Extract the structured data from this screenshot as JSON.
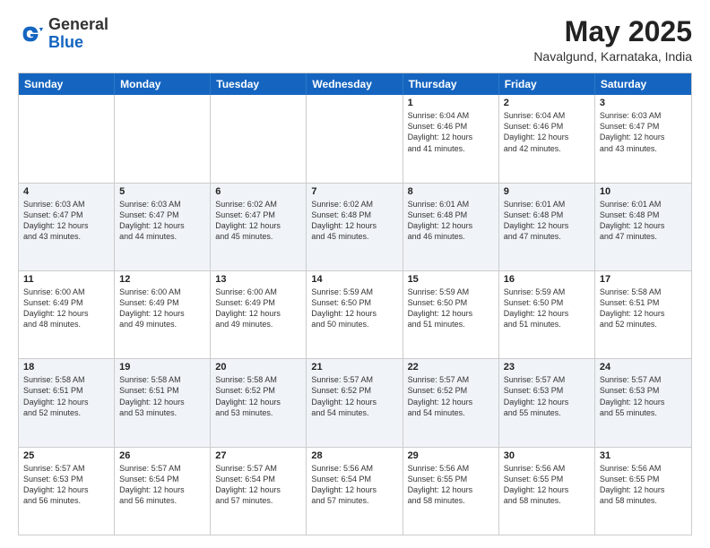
{
  "header": {
    "logo_general": "General",
    "logo_blue": "Blue",
    "month_title": "May 2025",
    "location": "Navalgund, Karnataka, India"
  },
  "weekdays": [
    "Sunday",
    "Monday",
    "Tuesday",
    "Wednesday",
    "Thursday",
    "Friday",
    "Saturday"
  ],
  "rows": [
    {
      "alt": false,
      "cells": [
        {
          "day": "",
          "info": ""
        },
        {
          "day": "",
          "info": ""
        },
        {
          "day": "",
          "info": ""
        },
        {
          "day": "",
          "info": ""
        },
        {
          "day": "1",
          "info": "Sunrise: 6:04 AM\nSunset: 6:46 PM\nDaylight: 12 hours\nand 41 minutes."
        },
        {
          "day": "2",
          "info": "Sunrise: 6:04 AM\nSunset: 6:46 PM\nDaylight: 12 hours\nand 42 minutes."
        },
        {
          "day": "3",
          "info": "Sunrise: 6:03 AM\nSunset: 6:47 PM\nDaylight: 12 hours\nand 43 minutes."
        }
      ]
    },
    {
      "alt": true,
      "cells": [
        {
          "day": "4",
          "info": "Sunrise: 6:03 AM\nSunset: 6:47 PM\nDaylight: 12 hours\nand 43 minutes."
        },
        {
          "day": "5",
          "info": "Sunrise: 6:03 AM\nSunset: 6:47 PM\nDaylight: 12 hours\nand 44 minutes."
        },
        {
          "day": "6",
          "info": "Sunrise: 6:02 AM\nSunset: 6:47 PM\nDaylight: 12 hours\nand 45 minutes."
        },
        {
          "day": "7",
          "info": "Sunrise: 6:02 AM\nSunset: 6:48 PM\nDaylight: 12 hours\nand 45 minutes."
        },
        {
          "day": "8",
          "info": "Sunrise: 6:01 AM\nSunset: 6:48 PM\nDaylight: 12 hours\nand 46 minutes."
        },
        {
          "day": "9",
          "info": "Sunrise: 6:01 AM\nSunset: 6:48 PM\nDaylight: 12 hours\nand 47 minutes."
        },
        {
          "day": "10",
          "info": "Sunrise: 6:01 AM\nSunset: 6:48 PM\nDaylight: 12 hours\nand 47 minutes."
        }
      ]
    },
    {
      "alt": false,
      "cells": [
        {
          "day": "11",
          "info": "Sunrise: 6:00 AM\nSunset: 6:49 PM\nDaylight: 12 hours\nand 48 minutes."
        },
        {
          "day": "12",
          "info": "Sunrise: 6:00 AM\nSunset: 6:49 PM\nDaylight: 12 hours\nand 49 minutes."
        },
        {
          "day": "13",
          "info": "Sunrise: 6:00 AM\nSunset: 6:49 PM\nDaylight: 12 hours\nand 49 minutes."
        },
        {
          "day": "14",
          "info": "Sunrise: 5:59 AM\nSunset: 6:50 PM\nDaylight: 12 hours\nand 50 minutes."
        },
        {
          "day": "15",
          "info": "Sunrise: 5:59 AM\nSunset: 6:50 PM\nDaylight: 12 hours\nand 51 minutes."
        },
        {
          "day": "16",
          "info": "Sunrise: 5:59 AM\nSunset: 6:50 PM\nDaylight: 12 hours\nand 51 minutes."
        },
        {
          "day": "17",
          "info": "Sunrise: 5:58 AM\nSunset: 6:51 PM\nDaylight: 12 hours\nand 52 minutes."
        }
      ]
    },
    {
      "alt": true,
      "cells": [
        {
          "day": "18",
          "info": "Sunrise: 5:58 AM\nSunset: 6:51 PM\nDaylight: 12 hours\nand 52 minutes."
        },
        {
          "day": "19",
          "info": "Sunrise: 5:58 AM\nSunset: 6:51 PM\nDaylight: 12 hours\nand 53 minutes."
        },
        {
          "day": "20",
          "info": "Sunrise: 5:58 AM\nSunset: 6:52 PM\nDaylight: 12 hours\nand 53 minutes."
        },
        {
          "day": "21",
          "info": "Sunrise: 5:57 AM\nSunset: 6:52 PM\nDaylight: 12 hours\nand 54 minutes."
        },
        {
          "day": "22",
          "info": "Sunrise: 5:57 AM\nSunset: 6:52 PM\nDaylight: 12 hours\nand 54 minutes."
        },
        {
          "day": "23",
          "info": "Sunrise: 5:57 AM\nSunset: 6:53 PM\nDaylight: 12 hours\nand 55 minutes."
        },
        {
          "day": "24",
          "info": "Sunrise: 5:57 AM\nSunset: 6:53 PM\nDaylight: 12 hours\nand 55 minutes."
        }
      ]
    },
    {
      "alt": false,
      "cells": [
        {
          "day": "25",
          "info": "Sunrise: 5:57 AM\nSunset: 6:53 PM\nDaylight: 12 hours\nand 56 minutes."
        },
        {
          "day": "26",
          "info": "Sunrise: 5:57 AM\nSunset: 6:54 PM\nDaylight: 12 hours\nand 56 minutes."
        },
        {
          "day": "27",
          "info": "Sunrise: 5:57 AM\nSunset: 6:54 PM\nDaylight: 12 hours\nand 57 minutes."
        },
        {
          "day": "28",
          "info": "Sunrise: 5:56 AM\nSunset: 6:54 PM\nDaylight: 12 hours\nand 57 minutes."
        },
        {
          "day": "29",
          "info": "Sunrise: 5:56 AM\nSunset: 6:55 PM\nDaylight: 12 hours\nand 58 minutes."
        },
        {
          "day": "30",
          "info": "Sunrise: 5:56 AM\nSunset: 6:55 PM\nDaylight: 12 hours\nand 58 minutes."
        },
        {
          "day": "31",
          "info": "Sunrise: 5:56 AM\nSunset: 6:55 PM\nDaylight: 12 hours\nand 58 minutes."
        }
      ]
    }
  ]
}
